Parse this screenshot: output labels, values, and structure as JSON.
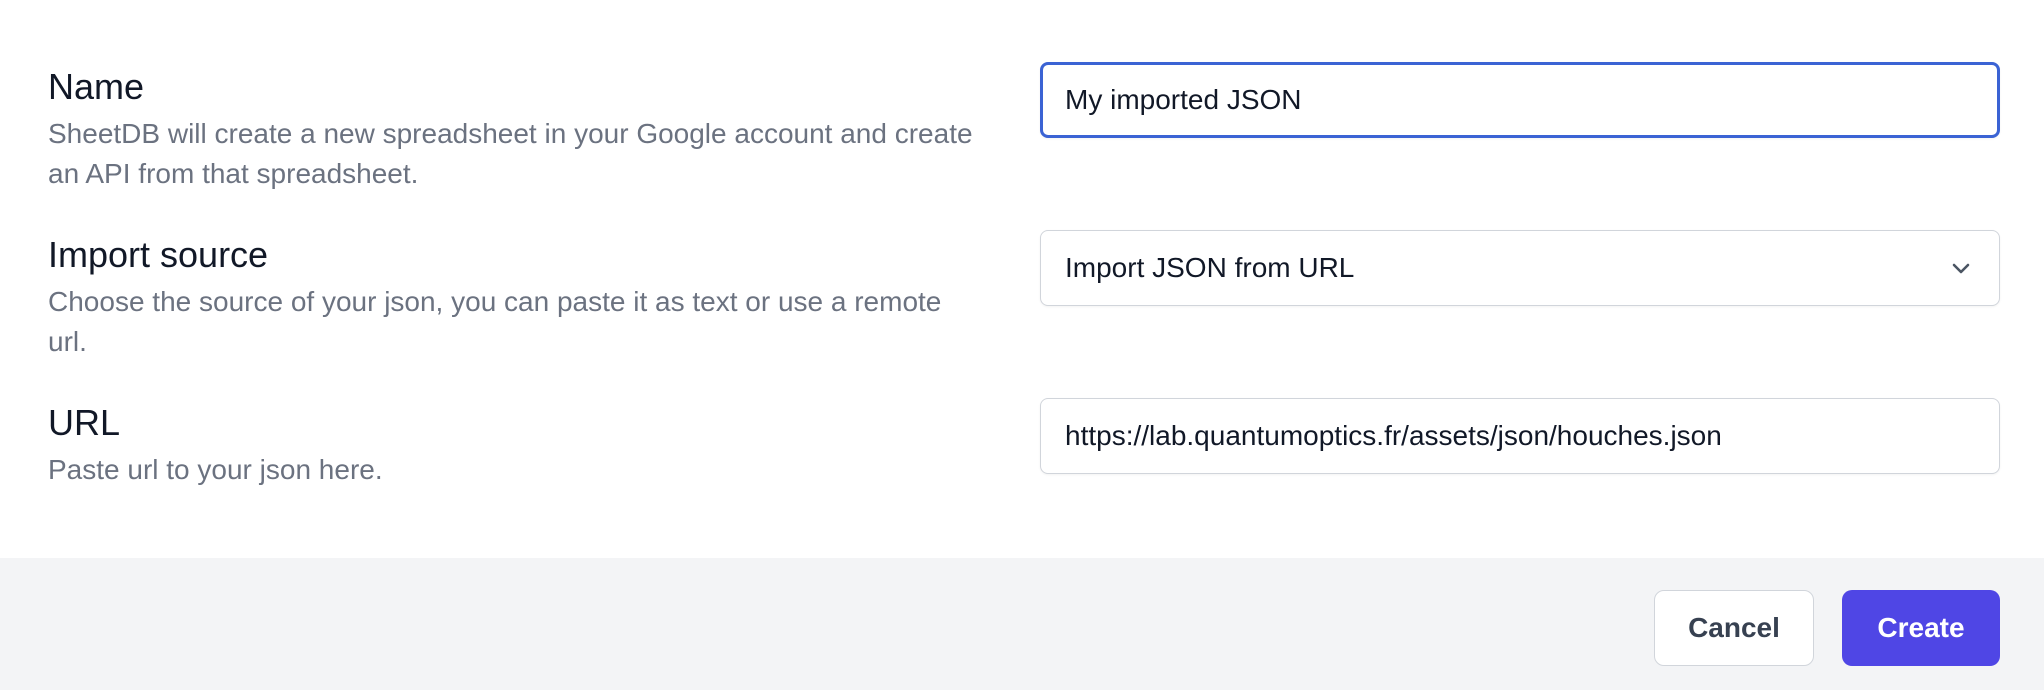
{
  "name_field": {
    "label": "Name",
    "help": "SheetDB will create a new spreadsheet in your Google account and create an API from that spreadsheet.",
    "value": "My imported JSON"
  },
  "source_field": {
    "label": "Import source",
    "help": "Choose the source of your json, you can paste it as text or use a remote url.",
    "selected": "Import JSON from URL",
    "icon": "chevron-down-icon"
  },
  "url_field": {
    "label": "URL",
    "help": "Paste url to your json here.",
    "value": "https://lab.quantumoptics.fr/assets/json/houches.json"
  },
  "footer": {
    "cancel_label": "Cancel",
    "create_label": "Create"
  },
  "colors": {
    "primary": "#4f46e5",
    "focus_ring": "#3b63d4",
    "footer_bg": "#f3f4f6",
    "label_text": "#111827",
    "help_text": "#6b7280"
  }
}
